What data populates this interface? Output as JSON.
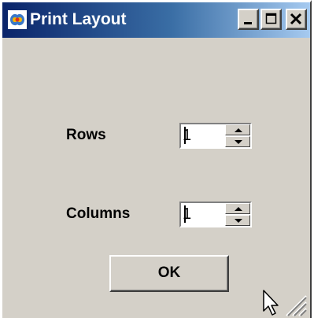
{
  "window": {
    "title": "Print Layout",
    "controls": [
      "minimize",
      "maximize",
      "close"
    ]
  },
  "form": {
    "rows_label": "Rows",
    "rows_value": "1",
    "columns_label": "Columns",
    "columns_value": "1"
  },
  "actions": {
    "ok_label": "OK"
  },
  "icons": {
    "app": "app-icon",
    "minimize": "minimize-icon",
    "maximize": "maximize-icon",
    "close": "close-icon",
    "spin_up": "arrow-up-icon",
    "spin_down": "arrow-down-icon",
    "resize_grip": "resize-grip-icon",
    "cursor": "mouse-pointer-icon"
  },
  "colors": {
    "title_start": "#0a246a",
    "title_end": "#a6caf0",
    "face": "#d4d0c8"
  }
}
